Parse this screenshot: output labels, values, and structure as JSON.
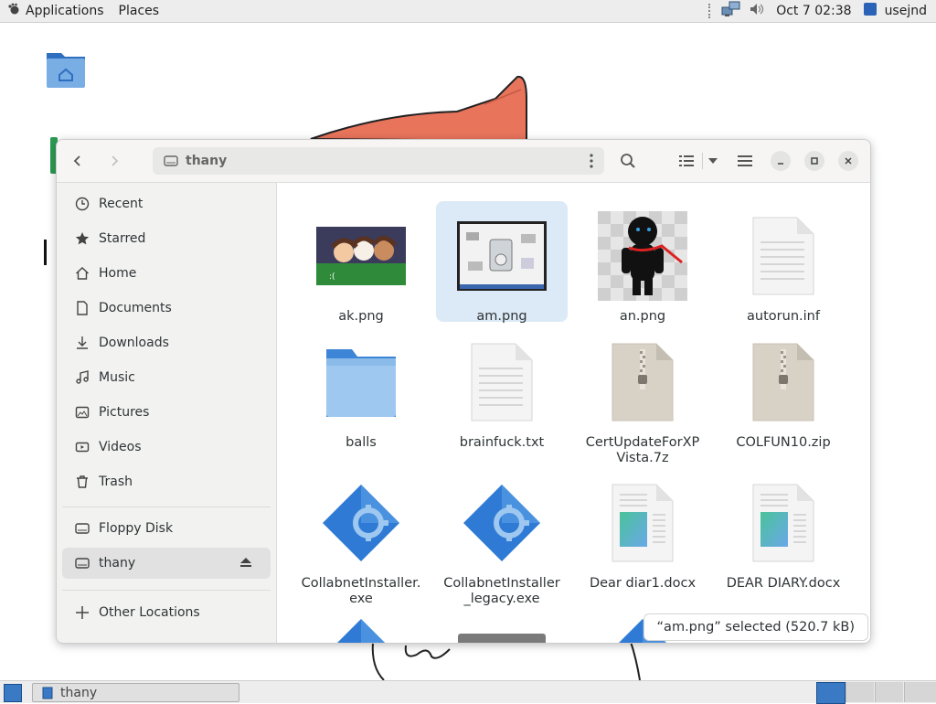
{
  "top_panel": {
    "applications": "Applications",
    "places": "Places",
    "datetime": "Oct 7  02:38",
    "user": "usejnd"
  },
  "window": {
    "path": "thany",
    "status": "“am.png” selected  (520.7 kB)"
  },
  "sidebar": {
    "items": [
      {
        "label": "Recent",
        "icon": "clock-icon"
      },
      {
        "label": "Starred",
        "icon": "star-icon"
      },
      {
        "label": "Home",
        "icon": "home-icon"
      },
      {
        "label": "Documents",
        "icon": "document-icon"
      },
      {
        "label": "Downloads",
        "icon": "download-icon"
      },
      {
        "label": "Music",
        "icon": "music-icon"
      },
      {
        "label": "Pictures",
        "icon": "picture-icon"
      },
      {
        "label": "Videos",
        "icon": "video-icon"
      },
      {
        "label": "Trash",
        "icon": "trash-icon"
      }
    ],
    "devices": [
      {
        "label": "Floppy Disk",
        "icon": "drive-icon"
      },
      {
        "label": "thany",
        "icon": "drive-icon",
        "active": true
      }
    ],
    "other": {
      "label": "Other Locations",
      "icon": "plus-icon"
    }
  },
  "files": [
    {
      "name": "ak.png",
      "kind": "image"
    },
    {
      "name": "am.png",
      "kind": "image",
      "selected": true
    },
    {
      "name": "an.png",
      "kind": "image"
    },
    {
      "name": "autorun.inf",
      "kind": "text"
    },
    {
      "name": "balls",
      "kind": "folder"
    },
    {
      "name": "brainfuck.txt",
      "kind": "text"
    },
    {
      "name": "CertUpdateForXP\nVista.7z",
      "kind": "archive"
    },
    {
      "name": "COLFUN10.zip",
      "kind": "archive"
    },
    {
      "name": "CollabnetInstaller.\nexe",
      "kind": "executable"
    },
    {
      "name": "CollabnetInstaller\n_legacy.exe",
      "kind": "executable"
    },
    {
      "name": "Dear diar1.docx",
      "kind": "document"
    },
    {
      "name": "DEAR DIARY.docx",
      "kind": "document"
    }
  ],
  "taskbar": {
    "window_label": "thany"
  },
  "colors": {
    "selection": "#dce9f6",
    "folder_blue": "#3d85d6",
    "accent": "#3a7ac4"
  }
}
